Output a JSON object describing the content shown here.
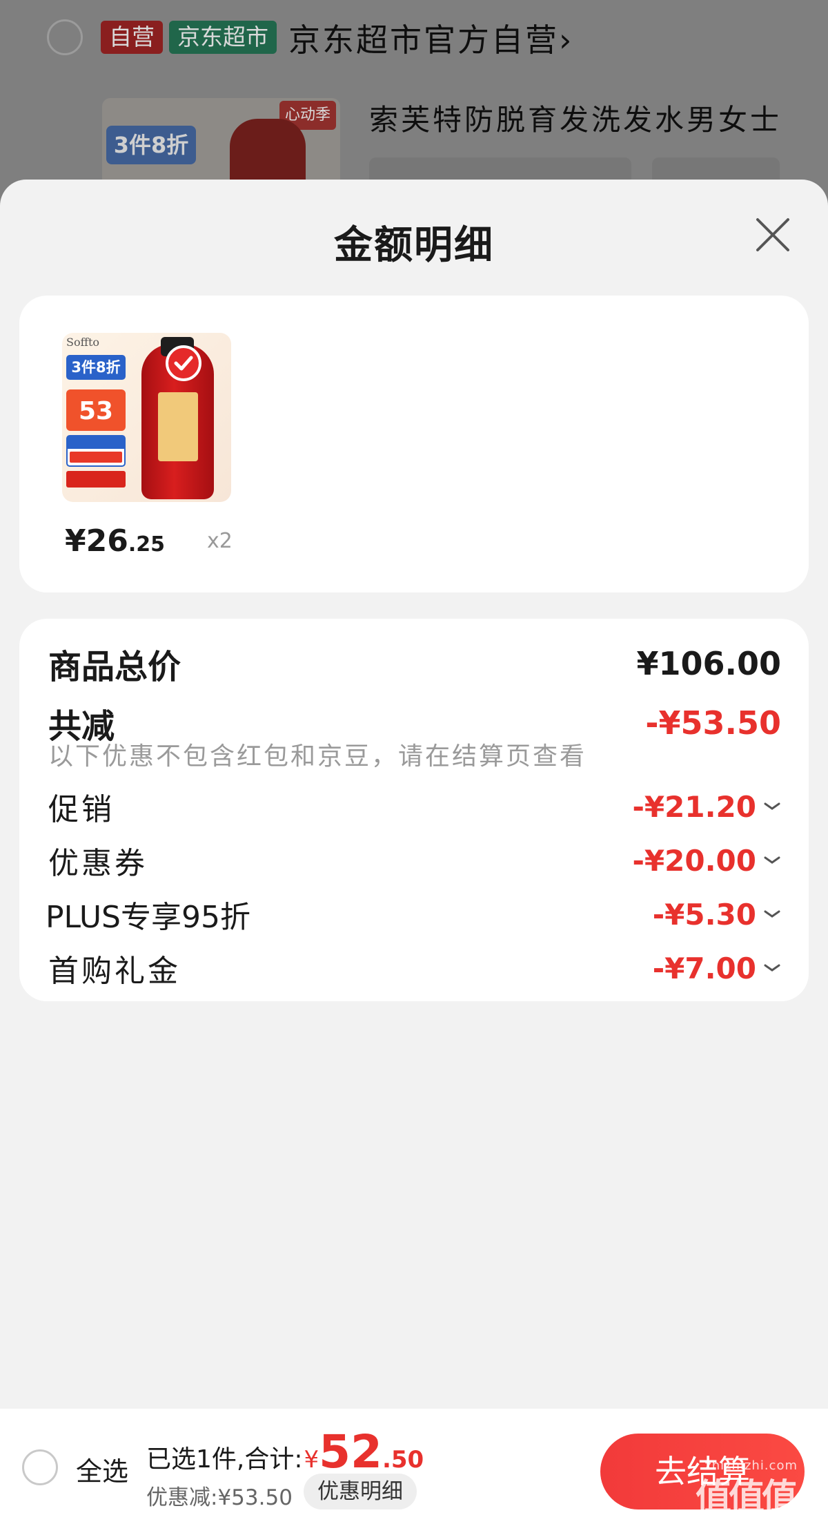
{
  "background": {
    "tag_self": "自营",
    "tag_market": "京东超市",
    "shop_name": "京东超市官方自营",
    "shop_arrow": "›",
    "product_title": "索芙特防脱育发洗发水男女士",
    "thumb_badge": "3件8折",
    "thumb_tag": "心动季"
  },
  "sheet": {
    "title": "金额明细",
    "close_icon": "close-icon"
  },
  "product": {
    "image_brand": "Soffto",
    "image_badge": "3件8折",
    "image_price": "53",
    "price_yen": "¥",
    "price_int": "26",
    "price_cents": ".25",
    "quantity": "x2"
  },
  "summary": {
    "total_label": "商品总价",
    "total_value": "¥106.00",
    "reduce_label": "共减",
    "reduce_value": "-¥53.50",
    "note": "以下优惠不包含红包和京豆，请在结算页查看",
    "items": [
      {
        "label": "促销",
        "value": "-¥21.20"
      },
      {
        "label": "优惠券",
        "value": "-¥20.00"
      },
      {
        "label": "PLUS专享95折",
        "value": "-¥5.30"
      },
      {
        "label": "首购礼金",
        "value": "-¥7.00"
      }
    ]
  },
  "bottom_bar": {
    "select_all": "全选",
    "selected_prefix": "已选1件,合计:",
    "total_yen": "¥",
    "total_big": "52",
    "total_small": ".50",
    "discount_text": "优惠减:¥53.50",
    "discount_detail": "优惠明细",
    "checkout": "去结算",
    "watermark": "值值值",
    "watermark_url": "zhizhizhi.com"
  },
  "colors": {
    "accent_red": "#e8312d",
    "checkout_red": "#f23a3a",
    "sheet_bg": "#f2f2f2",
    "card_bg": "#ffffff"
  }
}
